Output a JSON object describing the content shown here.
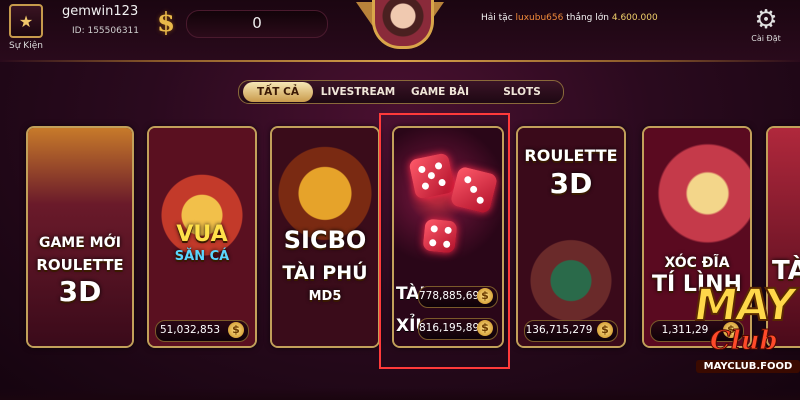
{
  "header": {
    "event_label": "Sự Kiện",
    "username": "gemwin123",
    "user_id": "ID: 155506311",
    "balance": "0",
    "ticker_prefix": "Hải tặc",
    "ticker_user": "luxubu656",
    "ticker_mid": "thắng lớn",
    "ticker_amount": "4.600.000",
    "settings_label": "Cài Đặt"
  },
  "tabs": [
    {
      "label": "TẤT CẢ",
      "active": true
    },
    {
      "label": "LIVESTREAM",
      "active": false
    },
    {
      "label": "GAME BÀI",
      "active": false
    },
    {
      "label": "SLOTS",
      "active": false
    }
  ],
  "games": [
    {
      "line1": "GAME MỚI",
      "line2": "ROULETTE",
      "line3": "3D",
      "side": "GAME MỚI"
    },
    {
      "title1": "VUA",
      "title2": "SĂN CÁ",
      "pot": "51,032,853"
    },
    {
      "title1": "SICBO",
      "title2": "TÀI PHÚ",
      "sub": "MD5"
    },
    {
      "tai_label": "TÀI",
      "tai_value": "778,885,691",
      "xiu_label": "XỈU",
      "xiu_value": "816,195,896"
    },
    {
      "title1": "ROULETTE",
      "title2": "3D",
      "pot": "136,715,279"
    },
    {
      "title1": "XÓC ĐĨA",
      "title2": "TÍ LÌNH",
      "pot": "1,311,29"
    },
    {
      "title1": "TÀ"
    }
  ],
  "logo": {
    "may": "MAY",
    "club": "Club",
    "domain": "MAYCLUB.FOOD"
  },
  "colors": {
    "accent_gold": "#d9a24a",
    "selection": "#ff3a3a"
  }
}
